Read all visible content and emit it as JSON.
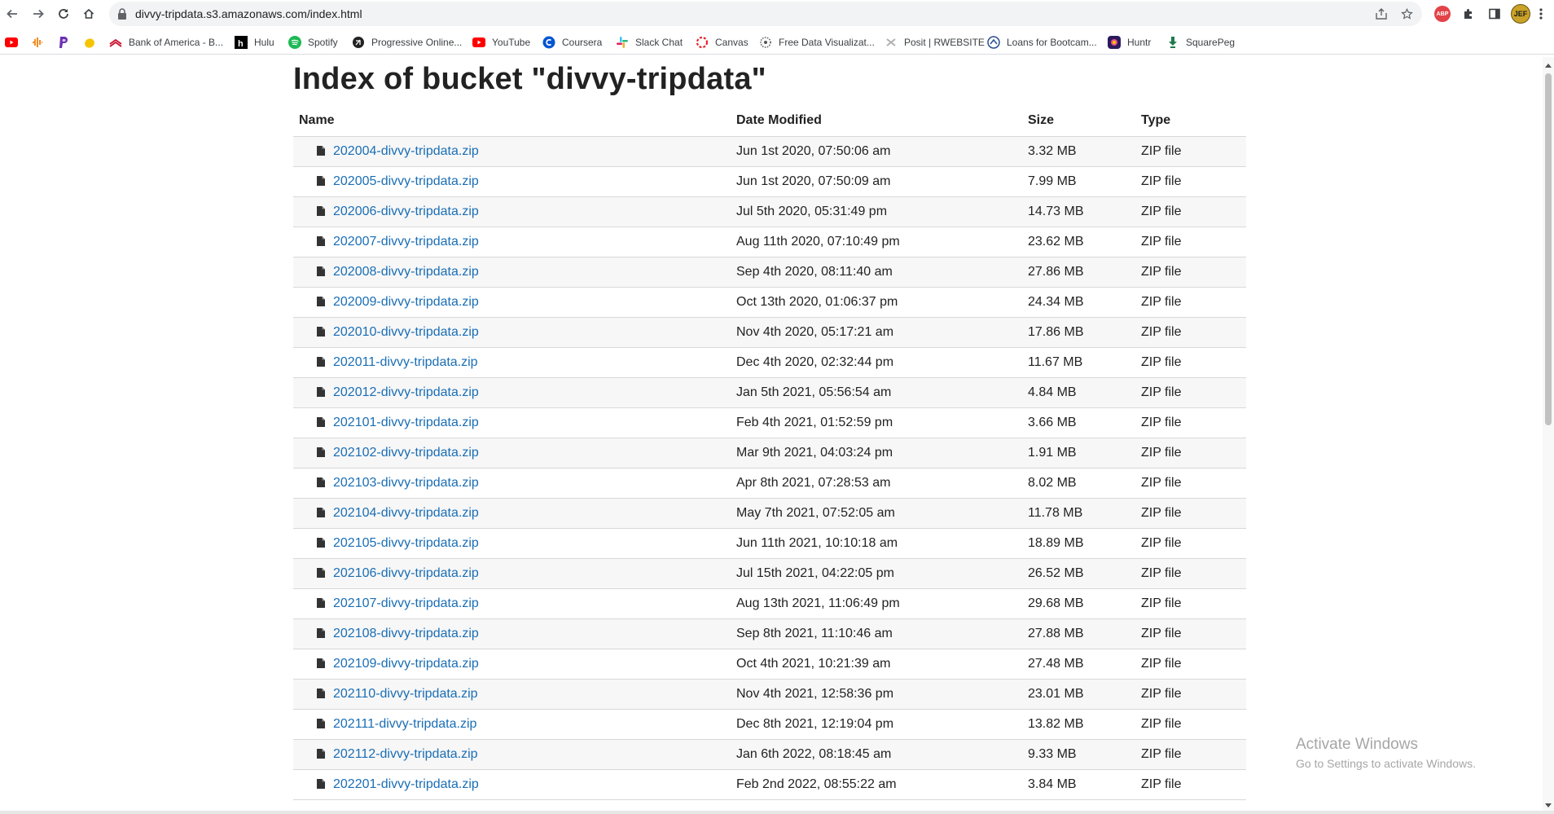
{
  "browser": {
    "url": "divvy-tripdata.s3.amazonaws.com/index.html",
    "extension_abp_label": "ABP",
    "profile_initials": "JEF"
  },
  "bookmarks": [
    {
      "label": "",
      "icon": "youtube-icon",
      "color": "#ff0000"
    },
    {
      "label": "",
      "icon": "audio-wave-icon",
      "color": "#f28b22"
    },
    {
      "label": "",
      "icon": "paypal-icon",
      "color": "#6b2fb3"
    },
    {
      "label": "",
      "icon": "egg-icon",
      "color": "#f5c400"
    },
    {
      "label": "Bank of America - B...",
      "icon": "bank-of-america-icon",
      "color": "#c8102e"
    },
    {
      "label": "Hulu",
      "icon": "hulu-icon",
      "color": "#000000"
    },
    {
      "label": "Spotify",
      "icon": "spotify-icon",
      "color": "#1db954"
    },
    {
      "label": "Progressive Online...",
      "icon": "progressive-icon",
      "color": "#222222"
    },
    {
      "label": "YouTube",
      "icon": "youtube-icon",
      "color": "#ff0000"
    },
    {
      "label": "Coursera",
      "icon": "coursera-icon",
      "color": "#0056d2"
    },
    {
      "label": "Slack Chat",
      "icon": "slack-icon",
      "color": "#4a154b"
    },
    {
      "label": "Canvas",
      "icon": "canvas-icon",
      "color": "#e72429"
    },
    {
      "label": "Free Data Visualizat...",
      "icon": "data-viz-icon",
      "color": "#555555"
    },
    {
      "label": "Posit | RWEBSITE",
      "icon": "posit-icon",
      "color": "#999999"
    },
    {
      "label": "Loans for Bootcam...",
      "icon": "loans-icon",
      "color": "#2a4d8f"
    },
    {
      "label": "Huntr",
      "icon": "huntr-icon",
      "color": "#6a1bbf"
    },
    {
      "label": "SquarePeg",
      "icon": "squarepeg-icon",
      "color": "#1f7a4c"
    }
  ],
  "page": {
    "title": "Index of bucket \"divvy-tripdata\"",
    "columns": {
      "name": "Name",
      "date": "Date Modified",
      "size": "Size",
      "type": "Type"
    },
    "files": [
      {
        "name": "202004-divvy-tripdata.zip",
        "date": "Jun 1st 2020, 07:50:06 am",
        "size": "3.32 MB",
        "type": "ZIP file"
      },
      {
        "name": "202005-divvy-tripdata.zip",
        "date": "Jun 1st 2020, 07:50:09 am",
        "size": "7.99 MB",
        "type": "ZIP file"
      },
      {
        "name": "202006-divvy-tripdata.zip",
        "date": "Jul 5th 2020, 05:31:49 pm",
        "size": "14.73 MB",
        "type": "ZIP file"
      },
      {
        "name": "202007-divvy-tripdata.zip",
        "date": "Aug 11th 2020, 07:10:49 pm",
        "size": "23.62 MB",
        "type": "ZIP file"
      },
      {
        "name": "202008-divvy-tripdata.zip",
        "date": "Sep 4th 2020, 08:11:40 am",
        "size": "27.86 MB",
        "type": "ZIP file"
      },
      {
        "name": "202009-divvy-tripdata.zip",
        "date": "Oct 13th 2020, 01:06:37 pm",
        "size": "24.34 MB",
        "type": "ZIP file"
      },
      {
        "name": "202010-divvy-tripdata.zip",
        "date": "Nov 4th 2020, 05:17:21 am",
        "size": "17.86 MB",
        "type": "ZIP file"
      },
      {
        "name": "202011-divvy-tripdata.zip",
        "date": "Dec 4th 2020, 02:32:44 pm",
        "size": "11.67 MB",
        "type": "ZIP file"
      },
      {
        "name": "202012-divvy-tripdata.zip",
        "date": "Jan 5th 2021, 05:56:54 am",
        "size": "4.84 MB",
        "type": "ZIP file"
      },
      {
        "name": "202101-divvy-tripdata.zip",
        "date": "Feb 4th 2021, 01:52:59 pm",
        "size": "3.66 MB",
        "type": "ZIP file"
      },
      {
        "name": "202102-divvy-tripdata.zip",
        "date": "Mar 9th 2021, 04:03:24 pm",
        "size": "1.91 MB",
        "type": "ZIP file"
      },
      {
        "name": "202103-divvy-tripdata.zip",
        "date": "Apr 8th 2021, 07:28:53 am",
        "size": "8.02 MB",
        "type": "ZIP file"
      },
      {
        "name": "202104-divvy-tripdata.zip",
        "date": "May 7th 2021, 07:52:05 am",
        "size": "11.78 MB",
        "type": "ZIP file"
      },
      {
        "name": "202105-divvy-tripdata.zip",
        "date": "Jun 11th 2021, 10:10:18 am",
        "size": "18.89 MB",
        "type": "ZIP file"
      },
      {
        "name": "202106-divvy-tripdata.zip",
        "date": "Jul 15th 2021, 04:22:05 pm",
        "size": "26.52 MB",
        "type": "ZIP file"
      },
      {
        "name": "202107-divvy-tripdata.zip",
        "date": "Aug 13th 2021, 11:06:49 pm",
        "size": "29.68 MB",
        "type": "ZIP file"
      },
      {
        "name": "202108-divvy-tripdata.zip",
        "date": "Sep 8th 2021, 11:10:46 am",
        "size": "27.88 MB",
        "type": "ZIP file"
      },
      {
        "name": "202109-divvy-tripdata.zip",
        "date": "Oct 4th 2021, 10:21:39 am",
        "size": "27.48 MB",
        "type": "ZIP file"
      },
      {
        "name": "202110-divvy-tripdata.zip",
        "date": "Nov 4th 2021, 12:58:36 pm",
        "size": "23.01 MB",
        "type": "ZIP file"
      },
      {
        "name": "202111-divvy-tripdata.zip",
        "date": "Dec 8th 2021, 12:19:04 pm",
        "size": "13.82 MB",
        "type": "ZIP file"
      },
      {
        "name": "202112-divvy-tripdata.zip",
        "date": "Jan 6th 2022, 08:18:45 am",
        "size": "9.33 MB",
        "type": "ZIP file"
      },
      {
        "name": "202201-divvy-tripdata.zip",
        "date": "Feb 2nd 2022, 08:55:22 am",
        "size": "3.84 MB",
        "type": "ZIP file"
      }
    ]
  },
  "watermark": {
    "title": "Activate Windows",
    "subtitle": "Go to Settings to activate Windows."
  }
}
